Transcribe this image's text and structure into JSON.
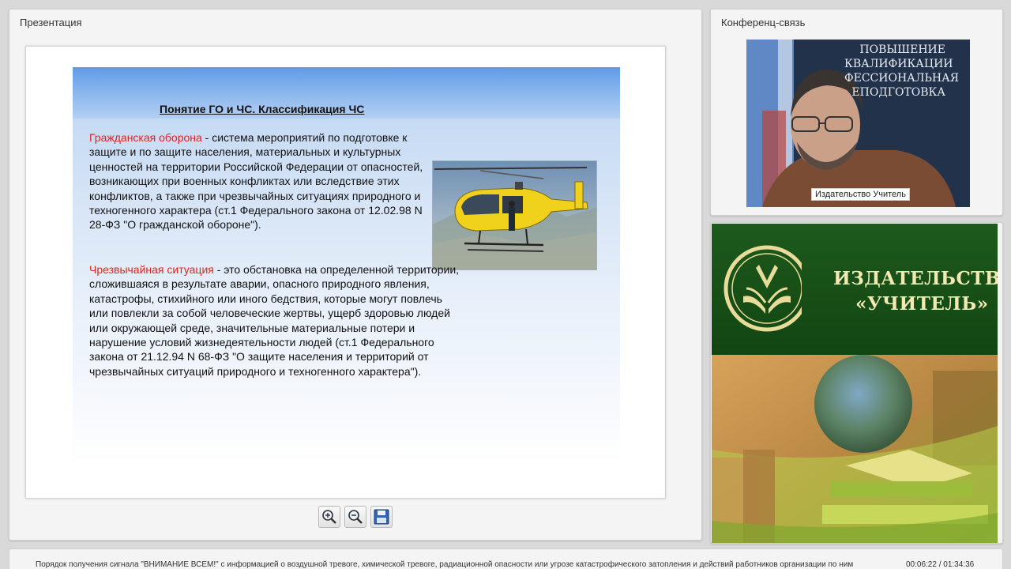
{
  "presentation": {
    "title": "Презентация",
    "slide": {
      "heading": "Понятие ГО и ЧС. Классификация ЧС",
      "term1": "Гражданская оборона",
      "text1": " - система мероприятий по подготовке к защите и по защите населения, материальных и культурных ценностей на территории Российской Федерации от опасностей, возникающих при военных конфликтах или вследствие этих конфликтов, а также при чрезвычайных ситуациях природного и техногенного характера (ст.1 Федерального закона от 12.02.98 N 28-ФЗ \"О гражданской обороне\").",
      "term2": "Чрезвычайная ситуация",
      "text2": " - это обстановка на определенной территории, сложившаяся в результате аварии, опасного природного явления, катастрофы, стихийного или иного бедствия, которые могут повлечь или повлекли за собой человеческие жертвы, ущерб здоровью людей или окружающей среде, значительные материальные потери и нарушение условий жизнедеятельности людей (ст.1 Федерального закона от 21.12.94 N 68-ФЗ \"О защите населения и территорий от чрезвычайных ситуаций природного и техногенного характера\")."
    },
    "toolbar": {
      "zoom_in_icon": "zoom-in-icon",
      "zoom_out_icon": "zoom-out-icon",
      "save_icon": "save-icon"
    }
  },
  "conference": {
    "title": "Конференц-связь",
    "participant_name": "Издательство Учитель",
    "backdrop_text_1": "ПОВЫШЕНИЕ",
    "backdrop_text_2": "КВАЛИФИКАЦИИ",
    "backdrop_text_3": "ФЕССИОНАЛЬНАЯ",
    "backdrop_text_4": "ЕПОДГОТОВКА"
  },
  "publisher": {
    "line1": "ИЗДАТЕЛЬСТВО",
    "line2": "«УЧИТЕЛЬ»"
  },
  "status": {
    "title": "Порядок получения сигнала \"ВНИМАНИЕ ВСЕМ!\" с информацией о воздушной тревоге, химической тревоге, радиационной опасности или угрозе катастрофического затопления и действий работников организации по ним",
    "time": "00:06:22 / 01:34:36"
  },
  "colors": {
    "term_red": "#e0241b",
    "banner_green": "#1d5a1c",
    "banner_gold": "#f3e9b3"
  }
}
